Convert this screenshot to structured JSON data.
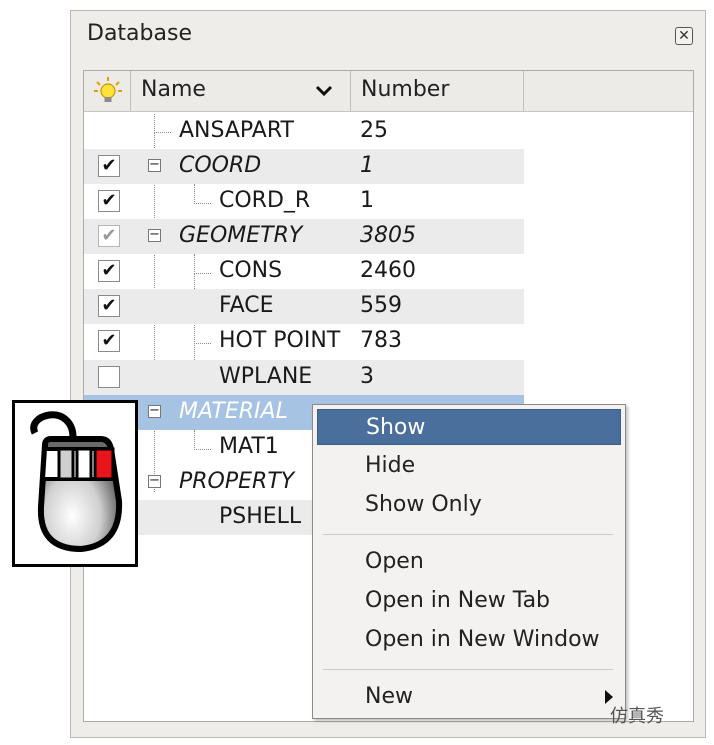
{
  "panel": {
    "title": "Database"
  },
  "header": {
    "name_label": "Name",
    "number_label": "Number"
  },
  "rows": [
    {
      "name": "ANSAPART",
      "number": "25"
    },
    {
      "name": "COORD",
      "number": "1"
    },
    {
      "name": "CORD_R",
      "number": "1"
    },
    {
      "name": "GEOMETRY",
      "number": "3805"
    },
    {
      "name": "CONS",
      "number": "2460"
    },
    {
      "name": "FACE",
      "number": "559"
    },
    {
      "name": "HOT POINT",
      "number": "783"
    },
    {
      "name": "WPLANE",
      "number": "3"
    },
    {
      "name": "MATERIAL",
      "number": ""
    },
    {
      "name": "MAT1",
      "number": ""
    },
    {
      "name": "PROPERTY",
      "number": ""
    },
    {
      "name": "PSHELL",
      "number": ""
    }
  ],
  "context_menu": {
    "items": [
      "Show",
      "Hide",
      "Show Only",
      "Open",
      "Open in New Tab",
      "Open in New Window",
      "New"
    ],
    "highlighted": "Show"
  },
  "watermark": "仿真秀",
  "colors": {
    "selection": "#a7c3e4",
    "menu_highlight": "#4a6f9d",
    "mouse_button_active": "#e8141c"
  },
  "icons": {
    "header": "lightbulb-icon",
    "close": "close-icon",
    "sort": "chevron-down-icon",
    "submenu": "arrow-right-icon",
    "mouse": "mouse-right-click-icon"
  }
}
